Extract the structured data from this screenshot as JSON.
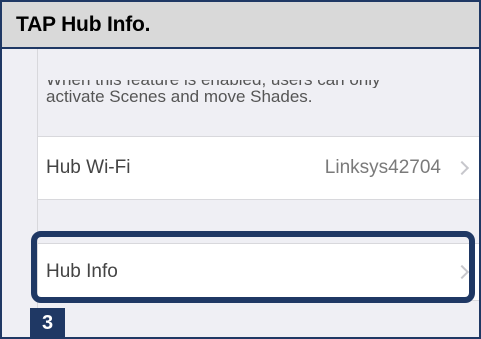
{
  "header": {
    "title": "TAP Hub Info."
  },
  "settings": {
    "note_line1": "When this feature is enabled, users can only",
    "note_line2": "activate Scenes and move Shades.",
    "hub_wifi": {
      "label": "Hub Wi-Fi",
      "value": "Linksys42704"
    },
    "hub_info": {
      "label": "Hub Info"
    }
  },
  "step": {
    "number": "3"
  },
  "colors": {
    "accent": "#1f3864",
    "header_bg": "#d9d9d9",
    "screen_bg": "#efeff4"
  },
  "icons": {
    "disclosure": "chevron-right-icon"
  }
}
